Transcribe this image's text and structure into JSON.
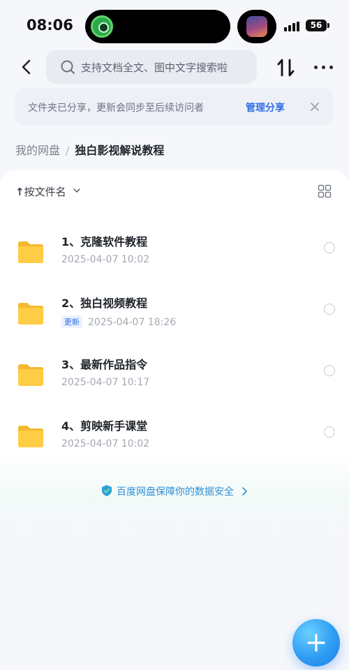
{
  "status_bar": {
    "time": "08:06",
    "battery": "56",
    "icons": [
      "app-activity-icon",
      "media-thumbnail-icon",
      "cellular-signal-icon",
      "battery-icon"
    ]
  },
  "header": {
    "back_icon": "chevron-left-icon",
    "search_placeholder": "支持文档全文、图中文字搜索啦",
    "sort_icon": "sort-arrows-icon",
    "more_icon": "more-dots-icon"
  },
  "share_banner": {
    "text": "文件夹已分享，更新会同步至后续访问者",
    "manage_label": "管理分享",
    "close_icon": "close-icon"
  },
  "breadcrumb": {
    "root": "我的网盘",
    "separator": "/",
    "current": "独白影视解说教程"
  },
  "toolbar": {
    "sort_arrow": "↑",
    "sort_label": "按文件名",
    "view_toggle_icon": "grid-view-icon"
  },
  "files": [
    {
      "name": "1、克隆软件教程",
      "badge": "",
      "date": "2025-04-07 10:02",
      "icon": "folder-icon"
    },
    {
      "name": "2、独白视频教程",
      "badge": "更新",
      "date": "2025-04-07 18:26",
      "icon": "folder-icon"
    },
    {
      "name": "3、最新作品指令",
      "badge": "",
      "date": "2025-04-07 10:17",
      "icon": "folder-icon"
    },
    {
      "name": "4、剪映新手课堂",
      "badge": "",
      "date": "2025-04-07 10:02",
      "icon": "folder-icon"
    }
  ],
  "safety": {
    "text": "百度网盘保障你的数据安全",
    "icon": "shield-icon"
  },
  "fab": {
    "icon": "plus-icon"
  },
  "colors": {
    "accent": "#2f6fe6",
    "folder": "#ffcb3d",
    "fab": "#2e9cf3",
    "safety_text": "#2f8fd6"
  }
}
